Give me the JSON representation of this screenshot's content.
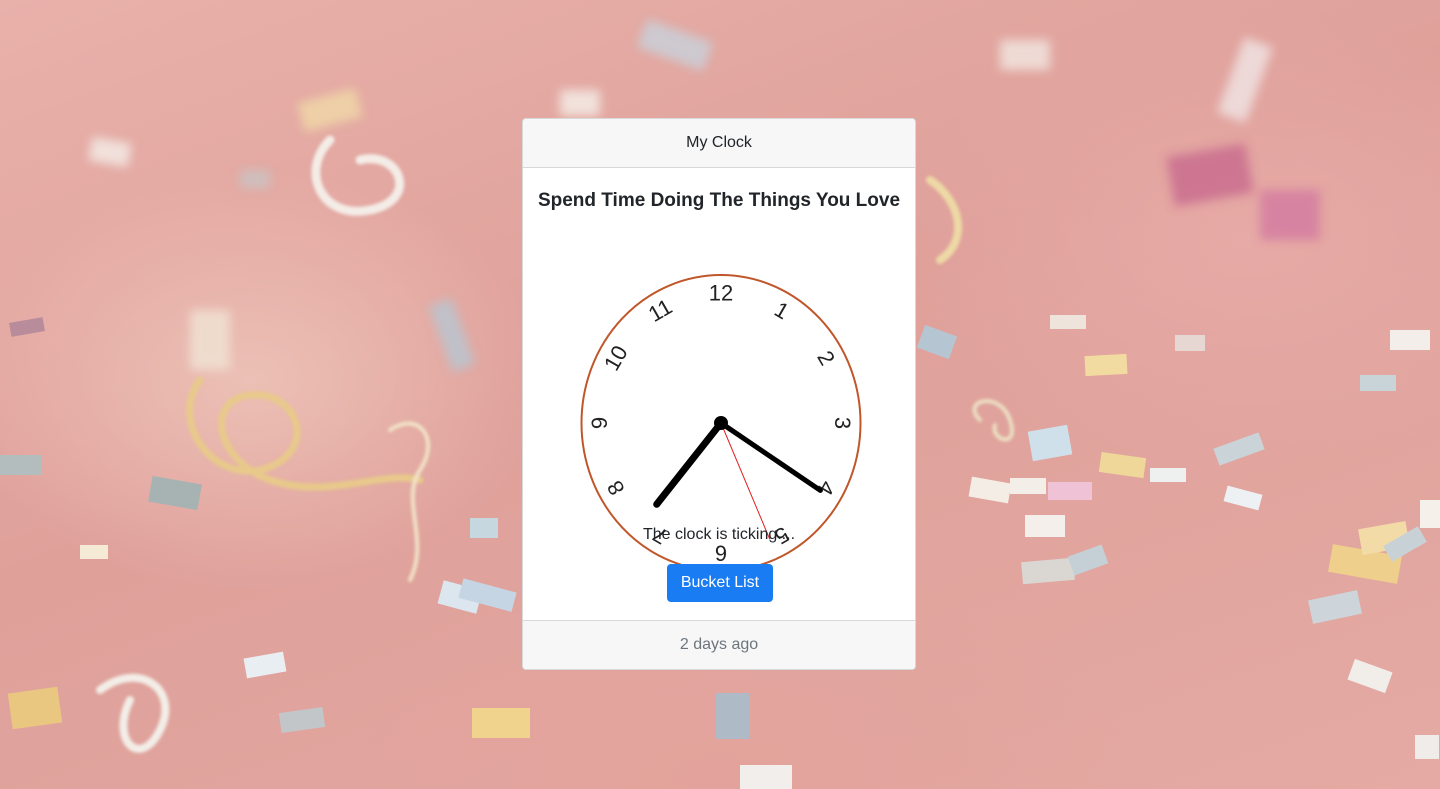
{
  "card": {
    "header": "My Clock",
    "title": "Spend Time Doing The Things You Love",
    "status_text": "The clock is ticking....",
    "button_label": "Bucket List",
    "footer": "2 days ago"
  },
  "clock": {
    "numerals": [
      "12",
      "1",
      "2",
      "3",
      "4",
      "5",
      "6",
      "7",
      "8",
      "9",
      "10",
      "11"
    ],
    "time": {
      "hours": 7,
      "minutes": 20,
      "seconds": 26
    },
    "colors": {
      "rim": "#c0572b",
      "hands": "#000000",
      "second_hand": "#e02020"
    }
  },
  "background": {
    "description_colors": [
      "#e8b1aa",
      "#dfa09a"
    ]
  }
}
